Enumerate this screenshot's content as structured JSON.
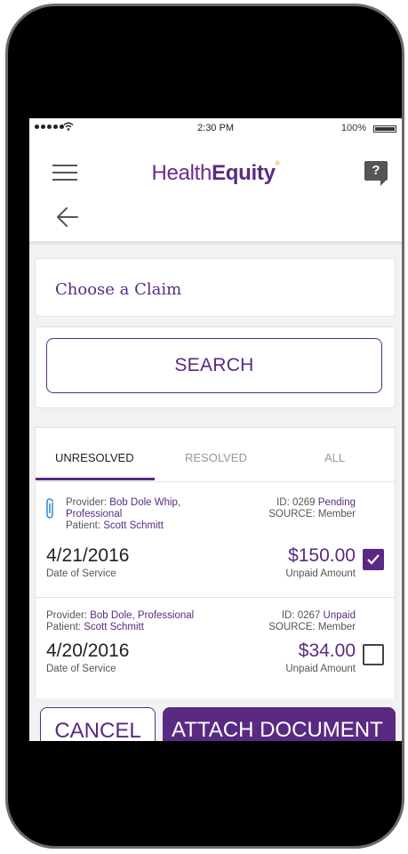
{
  "status_bar": {
    "time": "2:30 PM",
    "battery": "100%"
  },
  "header": {
    "logo_part1": "Health",
    "logo_part2": "Equity",
    "logo_mark": "®",
    "help_label": "?"
  },
  "claim_select": {
    "label": "Choose a Claim"
  },
  "search": {
    "label": "SEARCH"
  },
  "tabs": [
    {
      "label": "UNRESOLVED",
      "active": true
    },
    {
      "label": "RESOLVED",
      "active": false
    },
    {
      "label": "ALL",
      "active": false
    }
  ],
  "claims": [
    {
      "provider_label": "Provider:",
      "provider": "Bob Dole Whip,",
      "provider_line2": "Professional",
      "patient_label": "Patient:",
      "patient": "Scott Schmitt",
      "id_label": "ID:",
      "id": "0269",
      "status": "Pending",
      "source_label": "SOURCE:",
      "source": "Member",
      "date": "4/21/2016",
      "date_label": "Date of Service",
      "amount": "$150.00",
      "amount_label": "Unpaid Amount",
      "checked": true,
      "has_attachment": true
    },
    {
      "provider_label": "Provider:",
      "provider": "Bob Dole, Professional",
      "patient_label": "Patient:",
      "patient": "Scott Schmitt",
      "id_label": "ID:",
      "id": "0267",
      "status": "Unpaid",
      "source_label": "SOURCE:",
      "source": "Member",
      "date": "4/20/2016",
      "date_label": "Date of Service",
      "amount": "$34.00",
      "amount_label": "Unpaid Amount",
      "checked": false,
      "has_attachment": false
    }
  ],
  "footer": {
    "cancel_label": "CANCEL",
    "attach_label": "ATTACH DOCUMENT"
  },
  "colors": {
    "brand": "#5a2a82",
    "accent": "#e09020"
  },
  "icons": [
    "signal-dots-icon",
    "wifi-icon",
    "battery-icon",
    "hamburger-menu-icon",
    "help-icon",
    "back-arrow-icon",
    "paperclip-icon",
    "checkmark-icon"
  ]
}
